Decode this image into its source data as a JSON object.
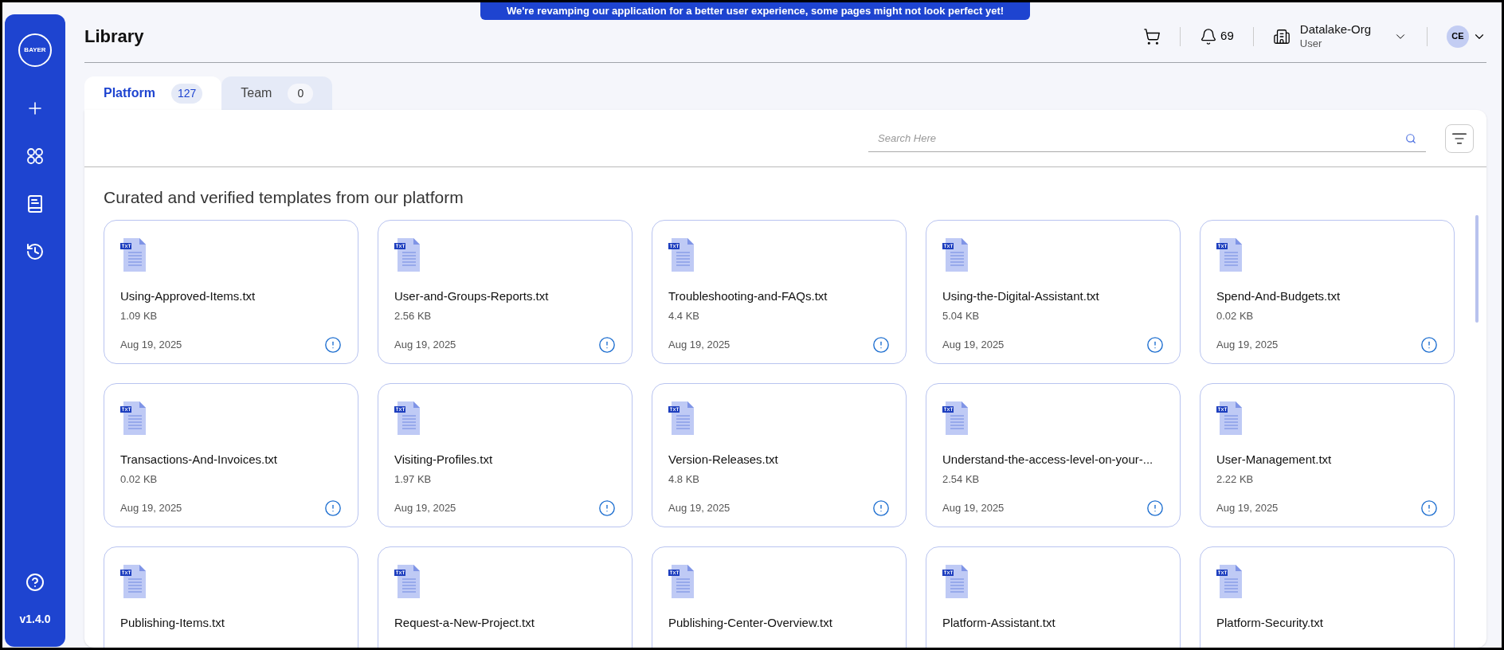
{
  "banner": "We're revamping our application for a better user experience, some pages might not look perfect yet!",
  "sidebar": {
    "logo": "BAYER",
    "version": "v1.4.0"
  },
  "header": {
    "title": "Library",
    "notifications": "69",
    "org": "Datalake-Org",
    "role": "User",
    "avatar": "CE"
  },
  "tabs": [
    {
      "label": "Platform",
      "count": "127",
      "selected": true
    },
    {
      "label": "Team",
      "count": "0",
      "selected": false
    }
  ],
  "search": {
    "placeholder": "Search Here"
  },
  "heading": "Curated and verified templates from our platform",
  "files": [
    {
      "name": "Using-Approved-Items.txt",
      "size": "1.09 KB",
      "date": "Aug 19, 2025"
    },
    {
      "name": "User-and-Groups-Reports.txt",
      "size": "2.56 KB",
      "date": "Aug 19, 2025"
    },
    {
      "name": "Troubleshooting-and-FAQs.txt",
      "size": "4.4 KB",
      "date": "Aug 19, 2025"
    },
    {
      "name": "Using-the-Digital-Assistant.txt",
      "size": "5.04 KB",
      "date": "Aug 19, 2025"
    },
    {
      "name": "Spend-And-Budgets.txt",
      "size": "0.02 KB",
      "date": "Aug 19, 2025"
    },
    {
      "name": "Transactions-And-Invoices.txt",
      "size": "0.02 KB",
      "date": "Aug 19, 2025"
    },
    {
      "name": "Visiting-Profiles.txt",
      "size": "1.97 KB",
      "date": "Aug 19, 2025"
    },
    {
      "name": "Version-Releases.txt",
      "size": "4.8 KB",
      "date": "Aug 19, 2025"
    },
    {
      "name": "Understand-the-access-level-on-your-...",
      "size": "2.54 KB",
      "date": "Aug 19, 2025"
    },
    {
      "name": "User-Management.txt",
      "size": "2.22 KB",
      "date": "Aug 19, 2025"
    },
    {
      "name": "Publishing-Items.txt"
    },
    {
      "name": "Request-a-New-Project.txt"
    },
    {
      "name": "Publishing-Center-Overview.txt"
    },
    {
      "name": "Platform-Assistant.txt"
    },
    {
      "name": "Platform-Security.txt"
    }
  ]
}
